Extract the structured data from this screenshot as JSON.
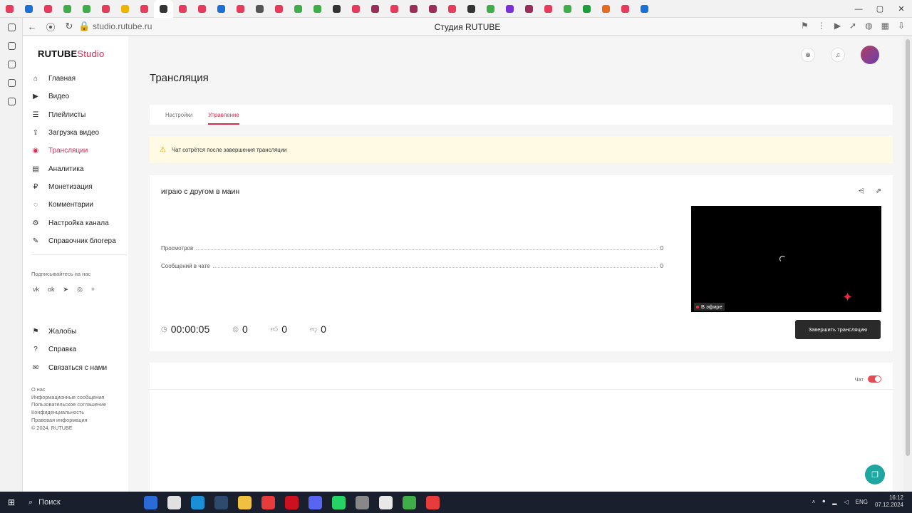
{
  "browser": {
    "url": "studio.rutube.ru",
    "title": "Студия RUTUBE",
    "tab_colors": [
      "#e83b5b",
      "#1a6fd8",
      "#e83b5b",
      "#3fae49",
      "#3fae49",
      "#e83b5b",
      "#f0b400",
      "#e83b5b",
      "#333333",
      "#e83b5b",
      "#e83b5b",
      "#1a6fd8",
      "#e83b5b",
      "#555555",
      "#e83b5b",
      "#3fae49",
      "#3fae49",
      "#333333",
      "#e83b5b",
      "#9b2d5a",
      "#e83b5b",
      "#9b2d5a",
      "#9b2d5a",
      "#e83b5b",
      "#333333",
      "#3fae49",
      "#7b2fd8",
      "#9b2d5a",
      "#e83b5b",
      "#3fae49",
      "#1f9d3a",
      "#e86a1c",
      "#e83b5b",
      "#1a6fd8"
    ]
  },
  "logo": {
    "main": "RUTUBE",
    "sub": "Studio"
  },
  "menu": [
    {
      "label": "Главная",
      "icon": "home-icon",
      "glyph": "⌂"
    },
    {
      "label": "Видео",
      "icon": "video-icon",
      "glyph": "▶"
    },
    {
      "label": "Плейлисты",
      "icon": "playlist-icon",
      "glyph": "☰"
    },
    {
      "label": "Загрузка видео",
      "icon": "upload-icon",
      "glyph": "⇪"
    },
    {
      "label": "Трансляции",
      "icon": "broadcast-icon",
      "glyph": "◉",
      "active": true
    },
    {
      "label": "Аналитика",
      "icon": "analytics-icon",
      "glyph": "▤"
    },
    {
      "label": "Монетизация",
      "icon": "monetization-icon",
      "glyph": "₽"
    },
    {
      "label": "Комментарии",
      "icon": "comments-icon",
      "glyph": "◌"
    },
    {
      "label": "Настройка канала",
      "icon": "settings-icon",
      "glyph": "⚙"
    },
    {
      "label": "Справочник блогера",
      "icon": "guide-icon",
      "glyph": "✎"
    }
  ],
  "subscribe_label": "Подписывайтесь на нас",
  "socials": [
    {
      "glyph": "vk",
      "icon": "vk-icon"
    },
    {
      "glyph": "ok",
      "icon": "ok-icon"
    },
    {
      "glyph": "➤",
      "icon": "telegram-icon"
    },
    {
      "glyph": "◎",
      "icon": "viber-icon"
    },
    {
      "glyph": "+",
      "icon": "more-icon"
    }
  ],
  "menu2": [
    {
      "label": "Жалобы",
      "icon": "flag-icon",
      "glyph": "⚑"
    },
    {
      "label": "Справка",
      "icon": "help-icon",
      "glyph": "?"
    },
    {
      "label": "Связаться с нами",
      "icon": "mail-icon",
      "glyph": "✉"
    }
  ],
  "footer_links": [
    "О нас",
    "Информационные сообщения",
    "Пользовательское соглашение",
    "Конфиденциальность",
    "Правовая информация",
    "© 2024, RUTUBE"
  ],
  "page_title": "Трансляция",
  "tabs": [
    {
      "label": "Настройки"
    },
    {
      "label": "Управление",
      "active": true
    }
  ],
  "warning": "Чат сотрётся после завершения трансляции",
  "stream": {
    "title": "играю с другом в маин",
    "stats": [
      {
        "label": "Просмотров",
        "value": "0"
      },
      {
        "label": "Сообщений в чате",
        "value": "0"
      }
    ],
    "duration": "00:00:05",
    "viewers": "0",
    "likes": "0",
    "dislikes": "0",
    "live_label": "В эфире",
    "end_button": "Завершить трансляцию"
  },
  "chat": {
    "label": "Чат",
    "enabled": true
  },
  "taskbar": {
    "search": "Поиск",
    "app_colors": [
      "#2a6bd8",
      "#e0e0e0",
      "#1a8fd6",
      "#2e4a6e",
      "#f0c040",
      "#e83b3b",
      "#cc1020",
      "#5865f2",
      "#25d366",
      "#888888",
      "#e8e8e8",
      "#3fae49",
      "#e83b3b"
    ],
    "lang": "ENG",
    "time": "16:12",
    "date": "07.12.2024"
  }
}
